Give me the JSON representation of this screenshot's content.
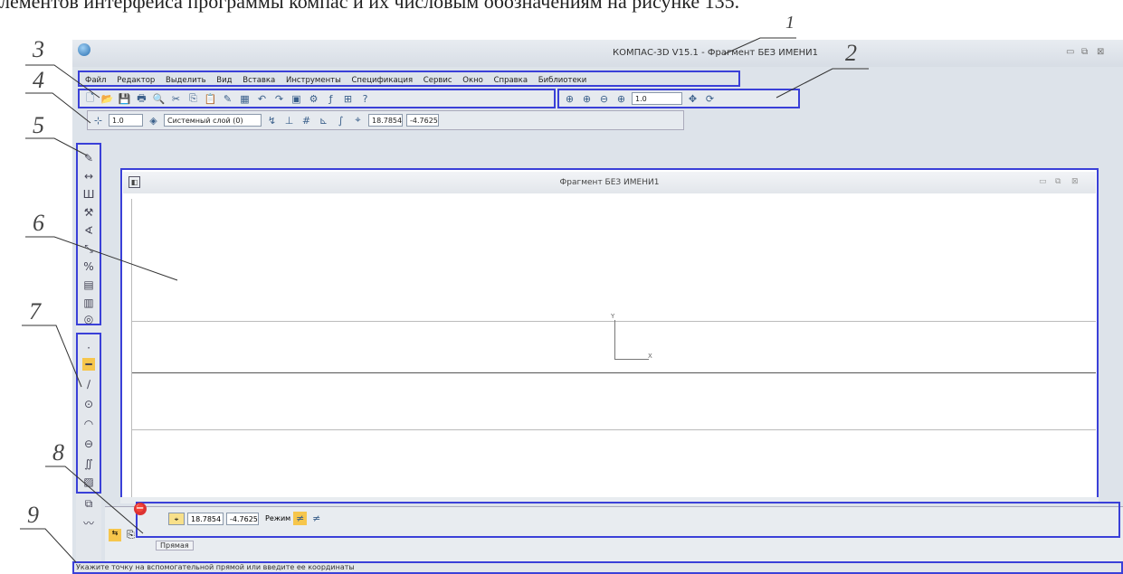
{
  "caption": "лементов интерфейса программы компас и их числовым обозначениям на рисунке 135.",
  "window": {
    "title": "КОМПАС-3D V15.1 - Фрагмент БЕЗ ИМЕНИ1",
    "controls": [
      "▭",
      "⧉",
      "⊠"
    ]
  },
  "menu": [
    "Файл",
    "Редактор",
    "Выделить",
    "Вид",
    "Вставка",
    "Инструменты",
    "Спецификация",
    "Сервис",
    "Окно",
    "Справка",
    "Библиотеки"
  ],
  "view_toolbar": {
    "zoom_value": "1.0"
  },
  "current_state": {
    "scale": "1.0",
    "layer": "Системный слой (0)",
    "x_coord": "18.7854",
    "y_coord": "-4.7625"
  },
  "document": {
    "title": "Фрагмент БЕЗ ИМЕНИ1",
    "axis_y": "Y",
    "axis_x": "X"
  },
  "property_panel": {
    "x_value": "18.7854",
    "y_value": "-4.7625",
    "mode_label": "Режим",
    "tab_label": "Прямая"
  },
  "status": {
    "text": "Укажите точку на вспомогательной прямой или введите ее координаты"
  },
  "callouts": {
    "n1": "1",
    "n2": "2",
    "n3": "3",
    "n4": "4",
    "n5": "5",
    "n6": "6",
    "n7": "7",
    "n8": "8",
    "n9": "9"
  },
  "colors": {
    "highlight": "#3a40d8",
    "toolbar": "#e6eaef",
    "workspace": "#dde3ea"
  }
}
